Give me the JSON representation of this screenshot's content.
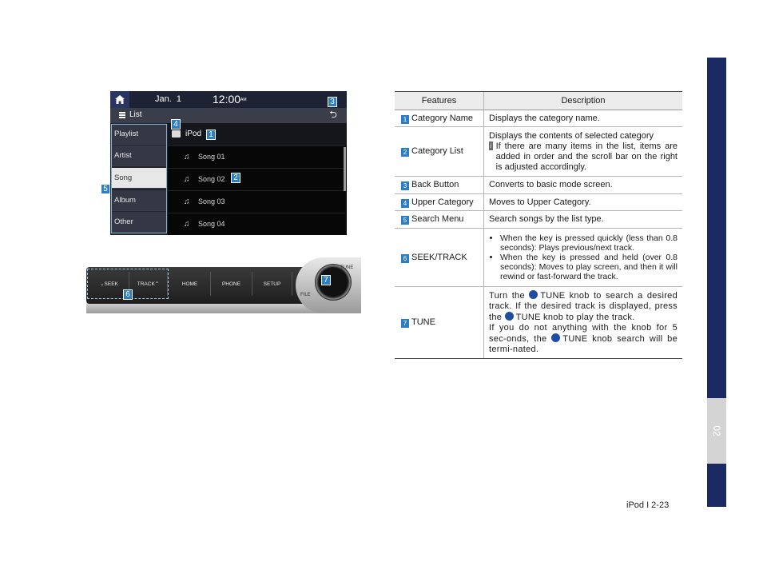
{
  "screen": {
    "date": "Jan.  1",
    "time": "12:00",
    "ampm": "AM",
    "list_label": "List",
    "menu": [
      "Playlist",
      "Artist",
      "Song",
      "Album",
      "Other"
    ],
    "category": "iPod",
    "songs": [
      "Song 01",
      "Song 02",
      "Song 03",
      "Song 04"
    ]
  },
  "panel": {
    "buttons": [
      "SEEK",
      "TRACK",
      "HOME",
      "PHONE",
      "SETUP"
    ],
    "tune_label": "TUNE",
    "file_label": "FILE"
  },
  "badges": [
    "1",
    "2",
    "3",
    "4",
    "5",
    "6",
    "7"
  ],
  "table": {
    "headers": [
      "Features",
      "Description"
    ],
    "rows": [
      {
        "num": "1",
        "feature": "Category Name",
        "desc": "Displays the category name."
      },
      {
        "num": "2",
        "feature": "Category List",
        "desc": "Displays the contents of selected category",
        "note": "If there are many items in the list, items are added in order and the scroll bar on the right is adjusted accordingly."
      },
      {
        "num": "3",
        "feature": "Back Button",
        "desc": "Converts to basic mode screen."
      },
      {
        "num": "4",
        "feature": "Upper Category",
        "desc": "Moves to Upper Category."
      },
      {
        "num": "5",
        "feature": "Search Menu",
        "desc": "Search songs by the list type."
      },
      {
        "num": "6",
        "feature": "SEEK/TRACK",
        "bullets": [
          "When the key is pressed quickly (less than 0.8 seconds): Plays previous/next track.",
          "When the key is pressed and held (over 0.8 seconds): Moves to play screen, and then it will rewind or fast-forward the track."
        ]
      },
      {
        "num": "7",
        "feature": "TUNE",
        "p1a": "Turn the",
        "p1b": "TUNE knob to search a desired track. If the desired track is displayed, press the",
        "p1c": "TUNE knob to play the track.",
        "p2a": "If you do not anything with the knob for 5 sec-onds, the",
        "p2b": "TUNE knob search will be termi-nated."
      }
    ]
  },
  "footer": "iPod I 2-23",
  "side_tab": "02",
  "colors": {
    "navy": "#1b2a63",
    "badge_blue": "#2c7fc7"
  }
}
